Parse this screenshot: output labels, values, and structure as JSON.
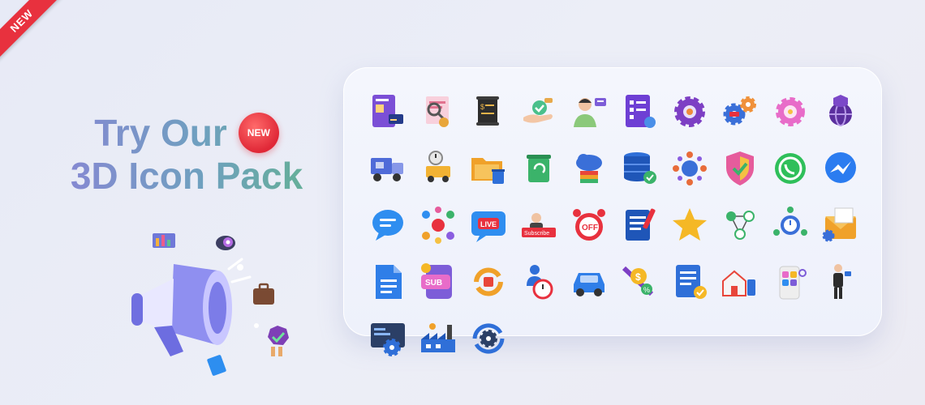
{
  "ribbon": {
    "label": "NEW"
  },
  "headline": {
    "line1": "Try Our",
    "badge": "NEW",
    "line2": "3D Icon Pack"
  },
  "icons": [
    "invoice-icon",
    "certificate-search-icon",
    "receipt-scroll-icon",
    "payment-hand-icon",
    "support-agent-icon",
    "checklist-icon",
    "gear-settings-icon",
    "gears-icon",
    "pink-gear-icon",
    "globe-shield-icon",
    "delivery-truck-icon",
    "fast-delivery-icon",
    "folder-trash-icon",
    "recycle-bin-icon",
    "cloud-storage-icon",
    "database-check-icon",
    "network-globe-icon",
    "shield-check-icon",
    "whatsapp-icon",
    "messenger-icon",
    "chat-bubble-icon",
    "social-icons-icon",
    "live-stream-icon",
    "subscribe-icon",
    "alarm-clock-icon",
    "notes-icon",
    "star-icon",
    "network-nodes-icon",
    "clock-process-icon",
    "email-settings-icon",
    "document-icon",
    "subscription-icon",
    "refresh-icon",
    "timer-user-icon",
    "car-icon",
    "currency-exchange-icon",
    "document-check-icon",
    "smart-home-icon",
    "app-grid-icon",
    "businessman-icon",
    "web-settings-icon",
    "factory-icon",
    "sync-gear-icon"
  ]
}
